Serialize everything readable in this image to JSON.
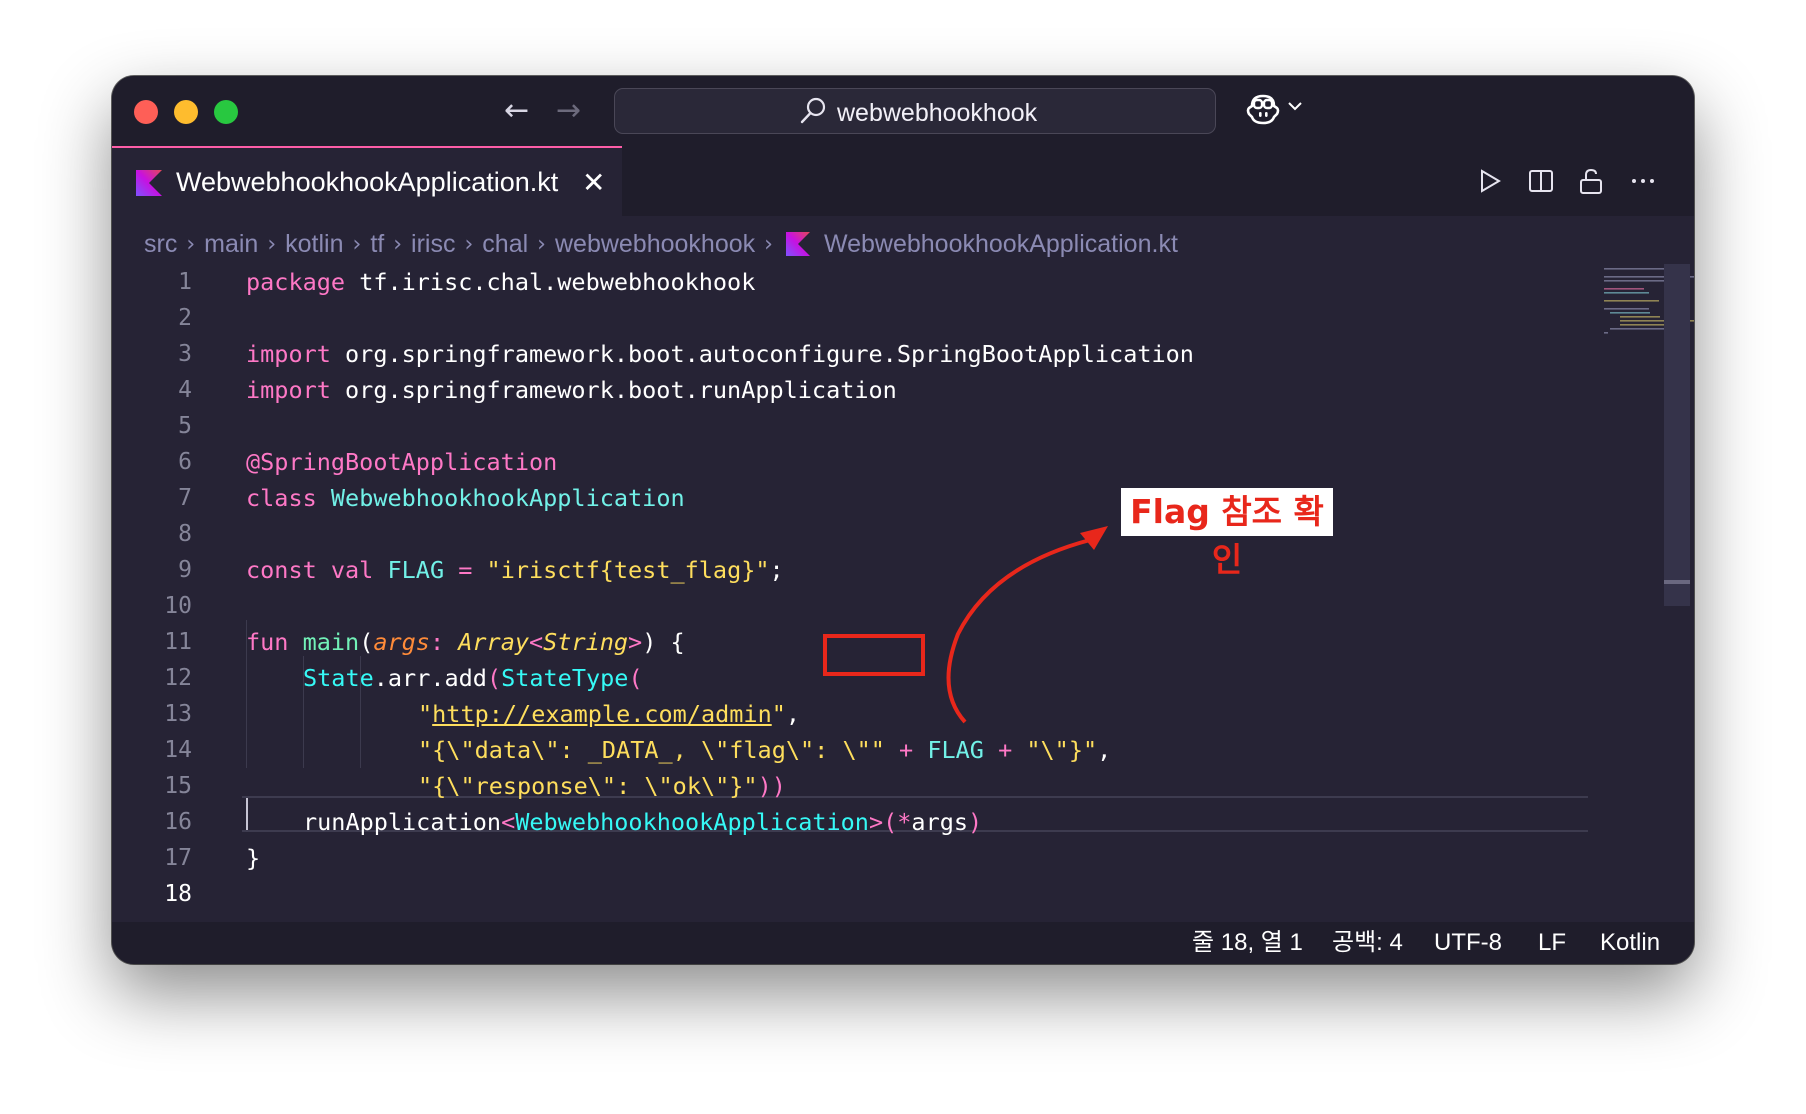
{
  "search": {
    "text": "webwebhookhook"
  },
  "tab": {
    "label": "WebwebhookhookApplication.kt",
    "close_glyph": "✕"
  },
  "nav": {
    "back": "←",
    "forward": "→"
  },
  "breadcrumb": {
    "items": [
      "src",
      "main",
      "kotlin",
      "tf",
      "irisc",
      "chal",
      "webwebhookhook"
    ],
    "file": "WebwebhookhookApplication.kt",
    "separator": "›"
  },
  "editor": {
    "line_numbers": [
      "1",
      "2",
      "3",
      "4",
      "5",
      "6",
      "7",
      "8",
      "9",
      "10",
      "11",
      "12",
      "13",
      "14",
      "15",
      "16",
      "17",
      "18"
    ],
    "current_line": 18,
    "tokens": {
      "l1_kw": "package",
      "l1_rest": " tf.irisc.chal.webwebhookhook",
      "l3_kw": "import",
      "l3_rest": " org.springframework.boot.autoconfigure.SpringBootApplication",
      "l4_kw": "import",
      "l4_rest": " org.springframework.boot.runApplication",
      "l6_ann": "@SpringBootApplication",
      "l7_kw": "class",
      "l7_type": "WebwebhookhookApplication",
      "l9_kw": "const val",
      "l9_name": "FLAG",
      "l9_eq": " = ",
      "l9_str": "\"irisctf{test_flag}\"",
      "l9_end": ";",
      "l11_kw": "fun",
      "l11_fn": "main",
      "l11_p1": "(",
      "l11_param": "args",
      "l11_colon": ": ",
      "l11_type": "Array",
      "l11_lt": "<",
      "l11_type2": "String",
      "l11_gt": ">",
      "l11_end": ") {",
      "l12_a": "State",
      "l12_b": ".arr.add",
      "l12_c": "(",
      "l12_d": "StateType",
      "l12_e": "(",
      "l13_q1": "\"",
      "l13_url": "http://example.com/admin",
      "l13_q2": "\"",
      "l13_end": ",",
      "l14_str1": "\"{\\\"data\\\": _DATA_, \\\"flag\\\": \\\"\"",
      "l14_plus1": " + ",
      "l14_flag": "FLAG",
      "l14_plus2": " + ",
      "l14_str2": "\"\\\"}\"",
      "l14_end": ",",
      "l15_str": "\"{\\\"response\\\": \\\"ok\\\"}\"",
      "l15_end": "))",
      "l16_fn": "runApplication",
      "l16_lt": "<",
      "l16_type": "WebwebhookhookApplication",
      "l16_gt": ">",
      "l16_p": "(",
      "l16_spread": "*",
      "l16_args": "args",
      "l16_end": ")",
      "l17": "}"
    }
  },
  "annotation": {
    "text": "Flag 참조 확인",
    "color": "#e8271b"
  },
  "statusbar": {
    "position": "줄 18, 열 1",
    "indent": "공백: 4",
    "encoding": "UTF-8",
    "eol": "LF",
    "language": "Kotlin"
  },
  "icons": [
    "search-icon",
    "copilot-icon",
    "run-icon",
    "split-editor-icon",
    "unlock-icon",
    "more-icon",
    "kotlin-file-icon"
  ]
}
